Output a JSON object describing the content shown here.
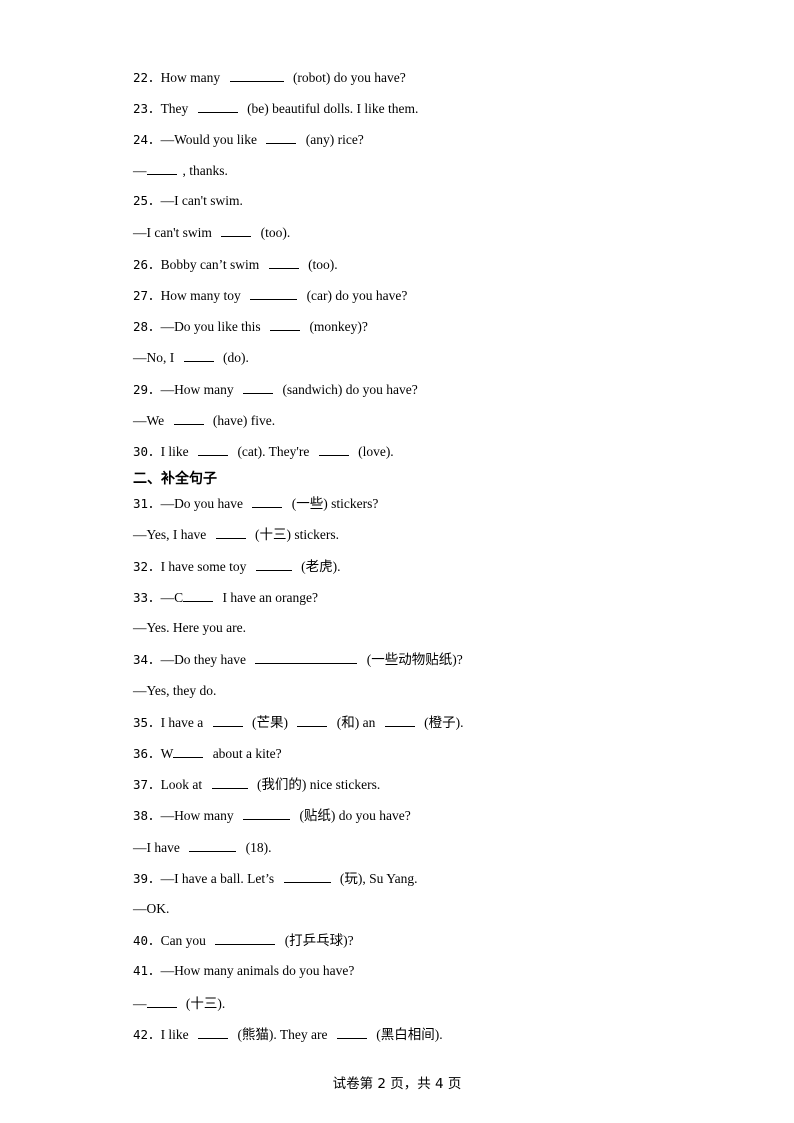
{
  "items": [
    {
      "id": "q22",
      "num": "22．",
      "parts": [
        "How many ",
        {
          "blank": 54
        },
        " (robot) do you have?"
      ]
    },
    {
      "id": "q23",
      "num": "23．",
      "parts": [
        "They ",
        {
          "blank": 40
        },
        " (be) beautiful dolls. I like them."
      ]
    },
    {
      "id": "q24a",
      "num": "24．",
      "parts": [
        "—Would you like ",
        {
          "blank": 30
        },
        " (any) rice?"
      ]
    },
    {
      "id": "q24b",
      "num": "",
      "parts": [
        "—",
        {
          "blank": 30,
          "tight": true
        },
        ", thanks."
      ]
    },
    {
      "id": "q25a",
      "num": "25．",
      "parts": [
        "—I can't swim."
      ]
    },
    {
      "id": "q25b",
      "num": "",
      "parts": [
        "—I can't swim ",
        {
          "blank": 30
        },
        " (too)."
      ]
    },
    {
      "id": "q26",
      "num": "26．",
      "parts": [
        "Bobby can’t swim ",
        {
          "blank": 30
        },
        " (too)."
      ]
    },
    {
      "id": "q27",
      "num": "27．",
      "parts": [
        "How many toy ",
        {
          "blank": 47
        },
        " (car) do you have?"
      ]
    },
    {
      "id": "q28a",
      "num": "28．",
      "parts": [
        "—Do you like this ",
        {
          "blank": 30
        },
        " (monkey)?"
      ]
    },
    {
      "id": "q28b",
      "num": "",
      "parts": [
        "—No, I ",
        {
          "blank": 30
        },
        " (do)."
      ]
    },
    {
      "id": "q29a",
      "num": "29．",
      "parts": [
        "—How many ",
        {
          "blank": 30
        },
        " (sandwich) do you have?"
      ]
    },
    {
      "id": "q29b",
      "num": "",
      "parts": [
        "—We ",
        {
          "blank": 30
        },
        " (have) five."
      ]
    },
    {
      "id": "q30",
      "num": "30．",
      "parts": [
        "I like ",
        {
          "blank": 30
        },
        " (cat). They're ",
        {
          "blank": 30
        },
        " (love)."
      ]
    },
    {
      "id": "q31a",
      "num": "31．",
      "parts": [
        "—Do you have ",
        {
          "blank": 30
        },
        " (一些) stickers?"
      ]
    },
    {
      "id": "q31b",
      "num": "",
      "parts": [
        "—Yes, I have ",
        {
          "blank": 30
        },
        " (十三) stickers."
      ]
    },
    {
      "id": "q32",
      "num": "32．",
      "parts": [
        "I have some toy ",
        {
          "blank": 36
        },
        " (老虎)."
      ]
    },
    {
      "id": "q33a",
      "num": "33．",
      "parts": [
        "—C",
        {
          "blank": 30,
          "tight": true
        },
        " I have an orange?"
      ]
    },
    {
      "id": "q33b",
      "num": "",
      "parts": [
        "—Yes. Here you are."
      ]
    },
    {
      "id": "q34a",
      "num": "34．",
      "parts": [
        "—Do they have ",
        {
          "blank": 102
        },
        " (一些动物贴纸)?"
      ]
    },
    {
      "id": "q34b",
      "num": "",
      "parts": [
        "—Yes, they do."
      ]
    },
    {
      "id": "q35",
      "num": "35．",
      "parts": [
        "I have a ",
        {
          "blank": 30
        },
        " (芒果) ",
        {
          "blank": 30
        },
        " (和) an ",
        {
          "blank": 30
        },
        " (橙子)."
      ]
    },
    {
      "id": "q36",
      "num": "36．",
      "parts": [
        "W",
        {
          "blank": 30,
          "tight": true
        },
        " about a kite?"
      ]
    },
    {
      "id": "q37",
      "num": "37．",
      "parts": [
        "Look at ",
        {
          "blank": 36
        },
        " (我们的) nice stickers."
      ]
    },
    {
      "id": "q38a",
      "num": "38．",
      "parts": [
        "—How many ",
        {
          "blank": 47
        },
        " (贴纸) do you have?"
      ]
    },
    {
      "id": "q38b",
      "num": "",
      "parts": [
        "—I have ",
        {
          "blank": 47
        },
        " (18)."
      ]
    },
    {
      "id": "q39a",
      "num": "39．",
      "parts": [
        "—I have a ball. Let’s ",
        {
          "blank": 47
        },
        " (玩), Su Yang."
      ]
    },
    {
      "id": "q39b",
      "num": "",
      "parts": [
        "—OK."
      ]
    },
    {
      "id": "q40",
      "num": "40．",
      "parts": [
        "Can you ",
        {
          "blank": 60
        },
        " (打乒乓球)?"
      ]
    },
    {
      "id": "q41a",
      "num": "41．",
      "parts": [
        "—How many animals do you have?"
      ]
    },
    {
      "id": "q41b",
      "num": "",
      "parts": [
        "—",
        {
          "blank": 30,
          "tight": true
        },
        " (十三)."
      ]
    },
    {
      "id": "q42",
      "num": "42．",
      "parts": [
        "I like ",
        {
          "blank": 30
        },
        " (熊猫). They are ",
        {
          "blank": 30
        },
        " (黑白相间)."
      ]
    }
  ],
  "section_heading": "二、补全句子",
  "footer": "试卷第 2 页，共 4 页"
}
